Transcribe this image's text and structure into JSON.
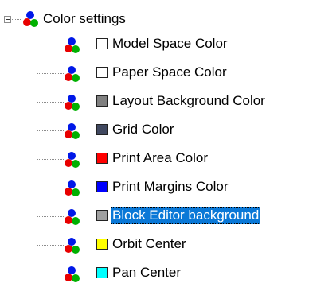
{
  "tree": {
    "root": {
      "label": "Color settings",
      "icon": "rgb-dots-icon",
      "expanded": true
    },
    "items": [
      {
        "label": "Model Space Color",
        "swatch": "#ffffff",
        "selected": false
      },
      {
        "label": "Paper Space Color",
        "swatch": "#ffffff",
        "selected": false
      },
      {
        "label": "Layout Background Color",
        "swatch": "#808080",
        "selected": false
      },
      {
        "label": "Grid Color",
        "swatch": "#404860",
        "selected": false
      },
      {
        "label": "Print Area Color",
        "swatch": "#ff0000",
        "selected": false
      },
      {
        "label": "Print Margins Color",
        "swatch": "#0000ff",
        "selected": false
      },
      {
        "label": "Block Editor background",
        "swatch": "#a0a0a0",
        "selected": true
      },
      {
        "label": "Orbit Center",
        "swatch": "#ffff00",
        "selected": false
      },
      {
        "label": "Pan Center",
        "swatch": "#00ffff",
        "selected": false
      }
    ]
  }
}
